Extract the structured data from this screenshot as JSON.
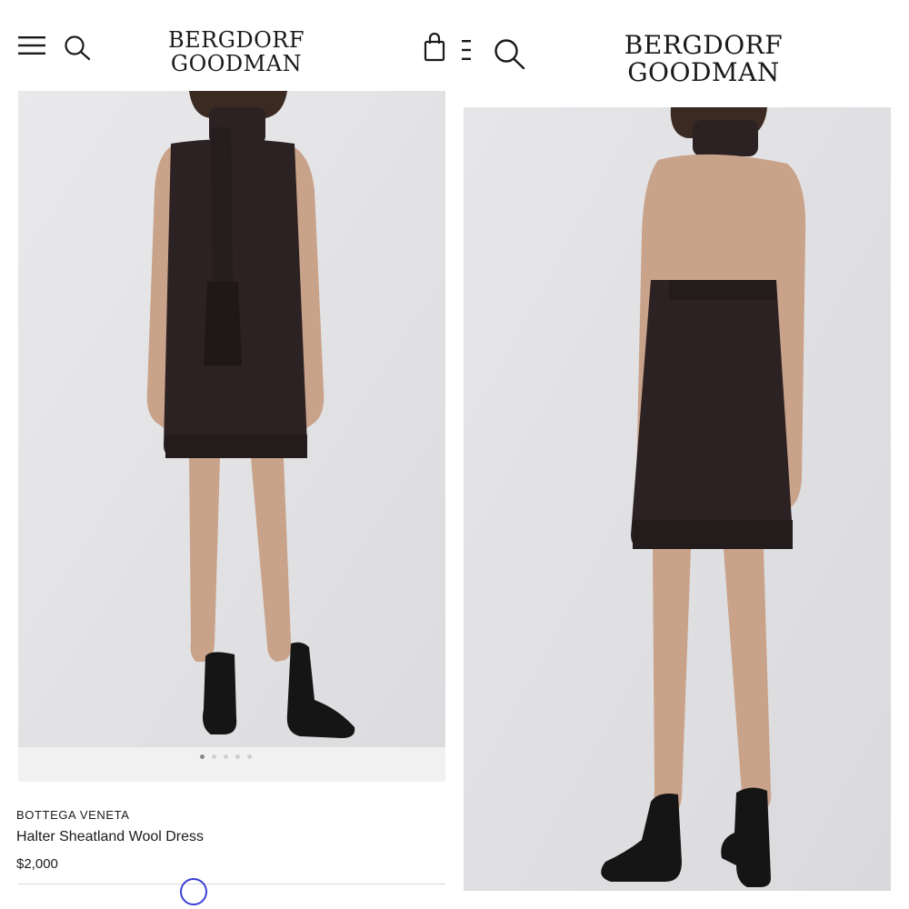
{
  "left_screen": {
    "header": {
      "logo_line1": "BERGDORF",
      "logo_line2": "GOODMAN",
      "icons": [
        "menu-icon",
        "search-icon",
        "shopping-bag-icon"
      ]
    },
    "gallery": {
      "image_count": 5,
      "active_index": 0
    },
    "product": {
      "brand": "BOTTEGA VENETA",
      "name": "Halter Sheatland Wool Dress",
      "price": "$2,000"
    }
  },
  "right_screen": {
    "header": {
      "logo_line1": "BERGDORF",
      "logo_line2": "GOODMAN",
      "icons": [
        "menu-icon",
        "search-icon"
      ]
    }
  },
  "colors": {
    "photo_background": "#e4e4e6",
    "dress": "#2c2123",
    "boots": "#151515",
    "skin": "#c9a28a",
    "accent_indicator": "#3a3fd4"
  }
}
